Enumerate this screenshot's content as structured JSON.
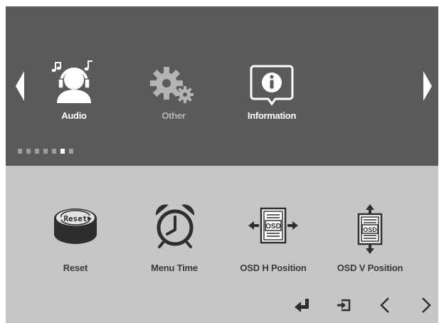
{
  "categories": [
    {
      "label": "Audio",
      "icon": "headphones-person-icon",
      "color": "#ffffff"
    },
    {
      "label": "Other",
      "icon": "gears-icon",
      "color": "#b4b4b4"
    },
    {
      "label": "Information",
      "icon": "info-icon",
      "color": "#ffffff"
    }
  ],
  "page_indicator": {
    "total": 7,
    "active": 6
  },
  "items": [
    {
      "label": "Reset",
      "icon": "reset-icon",
      "badge": "Reset"
    },
    {
      "label": "Menu Time",
      "icon": "alarm-clock-icon"
    },
    {
      "label": "OSD H Position",
      "icon": "osd-h-position-icon",
      "badge": "OSD"
    },
    {
      "label": "OSD V Position",
      "icon": "osd-v-position-icon",
      "badge": "OSD"
    }
  ],
  "controls": [
    {
      "icon": "enter-icon"
    },
    {
      "icon": "exit-icon"
    },
    {
      "icon": "chevron-left-icon"
    },
    {
      "icon": "chevron-right-icon"
    }
  ],
  "colors": {
    "top_bg": "#5a5a5a",
    "bottom_bg": "#c6c6c6",
    "icon_dark": "#2e2e2e"
  }
}
